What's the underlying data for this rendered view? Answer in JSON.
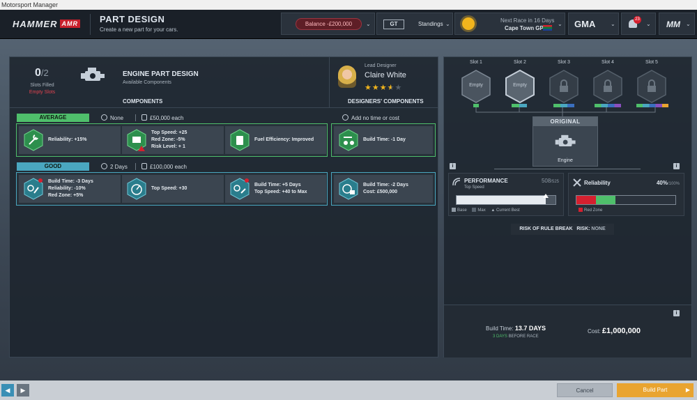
{
  "window": {
    "title": "Motorsport Manager"
  },
  "topbar": {
    "team_logo": "HAMMER",
    "team_badge": "AMR",
    "page_title": "PART DESIGN",
    "page_subtitle": "Create a new part for your cars.",
    "balance": "Balance -£200,000",
    "series_logo": "GT",
    "standings": "Standings",
    "next_race_label": "Next Race in 16 Days",
    "next_race_name": "Cape Town GP",
    "sponsor_logo": "GMA",
    "notifications_count": "23",
    "brand_logo": "MM"
  },
  "left": {
    "slots_filled_value": "0",
    "slots_filled_total": "/2",
    "slots_filled_label": "Slots Filled",
    "empty_slots_label": "Empty Slots",
    "section_title": "ENGINE PART DESIGN",
    "section_subtitle": "Available Components",
    "components_header": "COMPONENTS",
    "lead_designer_label": "Lead Designer",
    "lead_designer_name": "Claire White",
    "designer_rating": 3.5,
    "designers_header": "DESIGNERS' COMPONENTS",
    "tiers": [
      {
        "label": "AVERAGE",
        "time": "None",
        "cost": "£50,000 each",
        "color": "#4fbf6b",
        "components": [
          {
            "icon": "wrench-icon",
            "lines": [
              "Reliability: +15%"
            ]
          },
          {
            "icon": "engine-warning-icon",
            "lines": [
              "Top Speed: +25",
              "Red Zone: -5%",
              "Risk Level: + 1"
            ]
          },
          {
            "icon": "fuel-can-icon",
            "lines": [
              "Fuel Efficiency: Improved"
            ]
          }
        ],
        "designer_note": "Add no time or cost",
        "designer_component": {
          "icon": "wrench-car-icon",
          "lines": [
            "Build Time: -1 Day"
          ]
        }
      },
      {
        "label": "GOOD",
        "time": "2 Days",
        "cost": "£100,000 each",
        "color": "#4aa7c0",
        "components": [
          {
            "icon": "timer-wrench-icon",
            "lines": [
              "Build Time: -3 Days",
              "Reliability: -10%",
              "Red Zone: +5%"
            ]
          },
          {
            "icon": "gauge-icon",
            "lines": [
              "Top Speed: +30"
            ]
          },
          {
            "icon": "timer-gauge-icon",
            "lines": [
              "Build Time: +5 Days",
              "Top Speed: +40 to Max"
            ]
          }
        ],
        "designer_component": {
          "icon": "coins-timer-icon",
          "lines": [
            "Build Time: -2 Days",
            "Cost: £500,000"
          ]
        }
      }
    ]
  },
  "right": {
    "slots": [
      {
        "name": "Slot 1",
        "state": "Empty"
      },
      {
        "name": "Slot 2",
        "state": "Empty"
      },
      {
        "name": "Slot 3",
        "state": ""
      },
      {
        "name": "Slot 4",
        "state": ""
      },
      {
        "name": "Slot 5",
        "state": ""
      }
    ],
    "original_header": "ORIGINAL",
    "original_part": "Engine",
    "performance_title": "PERFORMANCE",
    "performance_sub": "Top Speed",
    "performance_value": "508",
    "performance_max": "/525",
    "performance_fraction": 0.9,
    "legend_base": "Base",
    "legend_max": "Max",
    "legend_current": "Current Best",
    "reliability_title": "Reliability",
    "reliability_value": "40%",
    "reliability_max": "/100%",
    "red_zone_fraction": 0.2,
    "reliability_fraction": 0.4,
    "legend_red_zone": "Red Zone",
    "risk_label": "RISK OF RULE BREAK",
    "risk_value_label": "RISK:",
    "risk_value": "NONE",
    "build_time_label": "Build Time:",
    "build_time_value": "13.7 DAYS",
    "before_race_days": "3 DAYS",
    "before_race_label": "BEFORE RACE",
    "cost_label": "Cost:",
    "cost_value": "£1,000,000"
  },
  "bottom": {
    "cancel": "Cancel",
    "build": "Build Part"
  },
  "colors": {
    "average": "#4fbf6b",
    "good": "#4aa7c0",
    "accent_orange": "#e9a430",
    "danger": "#d5202f"
  }
}
